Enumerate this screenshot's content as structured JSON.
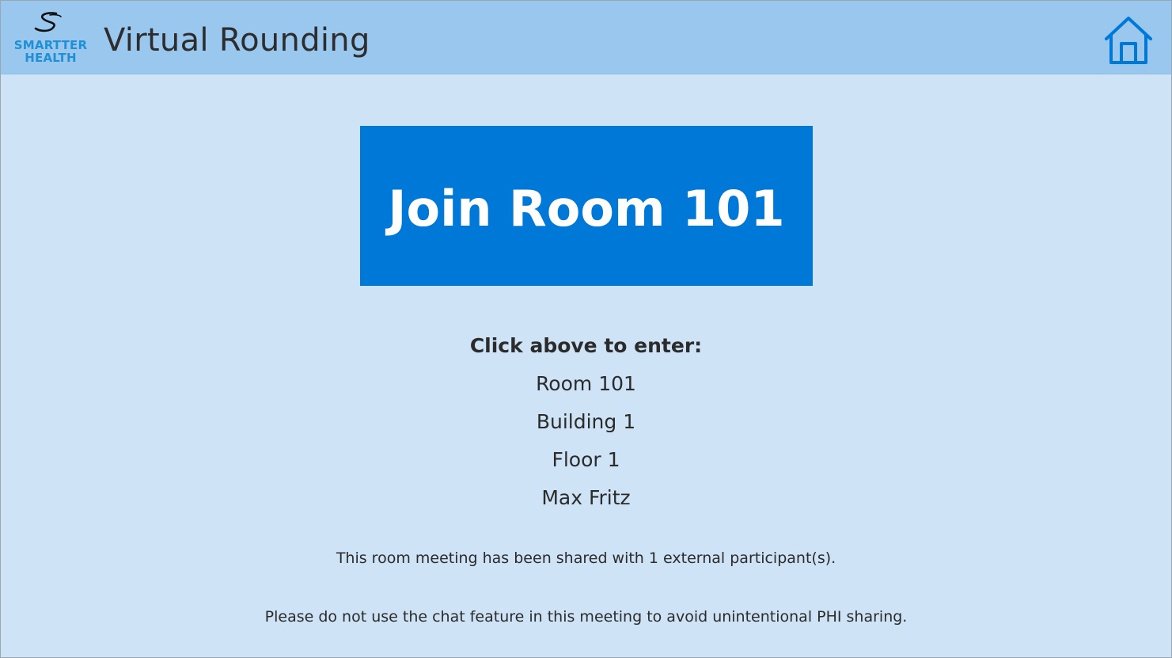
{
  "header": {
    "logo_text_line1": "SMARTTER",
    "logo_text_line2": "HEALTH",
    "app_title": "Virtual Rounding",
    "home_icon": "home-icon"
  },
  "main": {
    "join_button_label": "Join Room 101",
    "instructions_heading": "Click above to enter:",
    "details": {
      "room": "Room 101",
      "building": "Building 1",
      "floor": "Floor 1",
      "patient": "Max Fritz"
    },
    "shared_notice": "This room meeting has been shared with 1 external participant(s).",
    "chat_warning": "Please do not use the chat feature in this meeting to avoid unintentional PHI sharing."
  },
  "colors": {
    "header_bg": "#99c7ee",
    "page_bg": "#cfe3f6",
    "button_bg": "#0078d7",
    "brand_blue": "#1f8fd6"
  }
}
